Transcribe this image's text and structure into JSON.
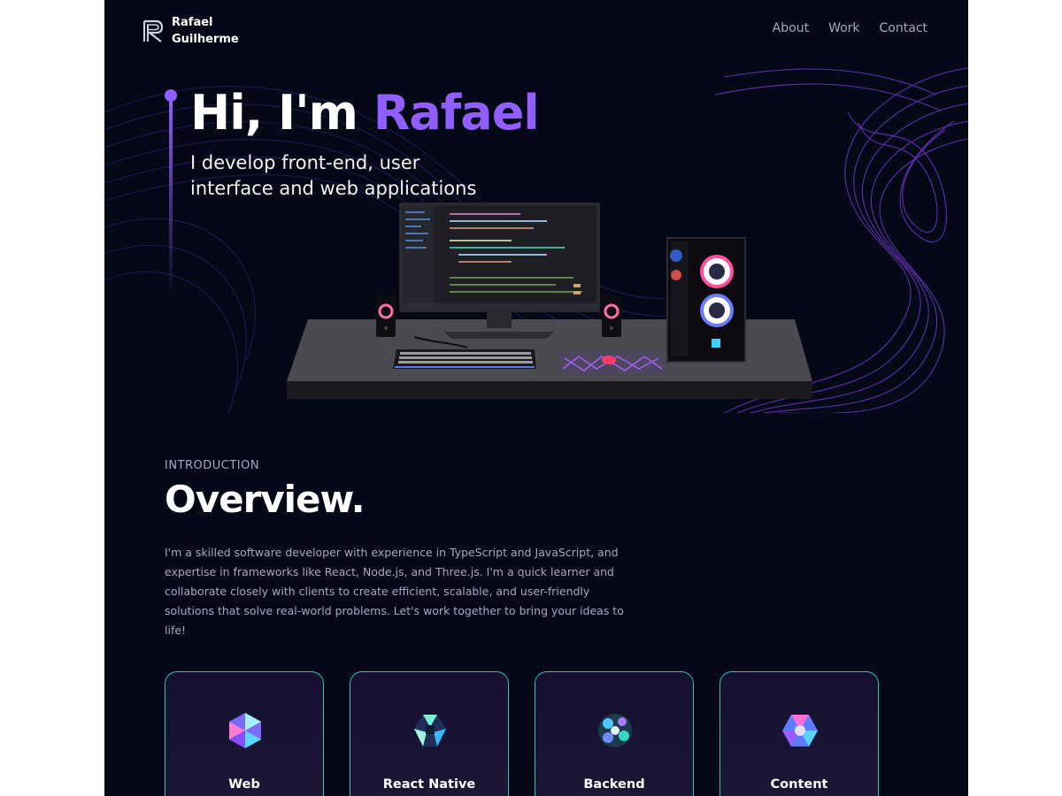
{
  "header": {
    "logo_line1": "Rafael",
    "logo_line2": "Guilherme",
    "nav": [
      {
        "label": "About"
      },
      {
        "label": "Work"
      },
      {
        "label": "Contact"
      }
    ]
  },
  "hero": {
    "title_prefix": "Hi, I'm",
    "title_name": "Rafael",
    "subtitle_line1": "I develop front-end, user",
    "subtitle_line2": "interface and web applications"
  },
  "overview": {
    "kicker": "INTRODUCTION",
    "title": "Overview.",
    "text": "I'm a skilled software developer with experience in TypeScript and JavaScript, and expertise in frameworks like React, Node.js, and Three.js. I'm a quick learner and collaborate closely with clients to create efficient, scalable, and user-friendly solutions that solve real-world problems. Let's work together to bring your ideas to life!"
  },
  "services": [
    {
      "title": "Web",
      "icon": "web-icon"
    },
    {
      "title": "React Native",
      "icon": "react-native-icon"
    },
    {
      "title": "Backend",
      "icon": "backend-icon"
    },
    {
      "title": "Content",
      "icon": "content-icon"
    }
  ],
  "colors": {
    "background": "#050816",
    "accent": "#915eff",
    "secondary_text": "#aaa6c3",
    "card_border": "#2fc6b2"
  }
}
